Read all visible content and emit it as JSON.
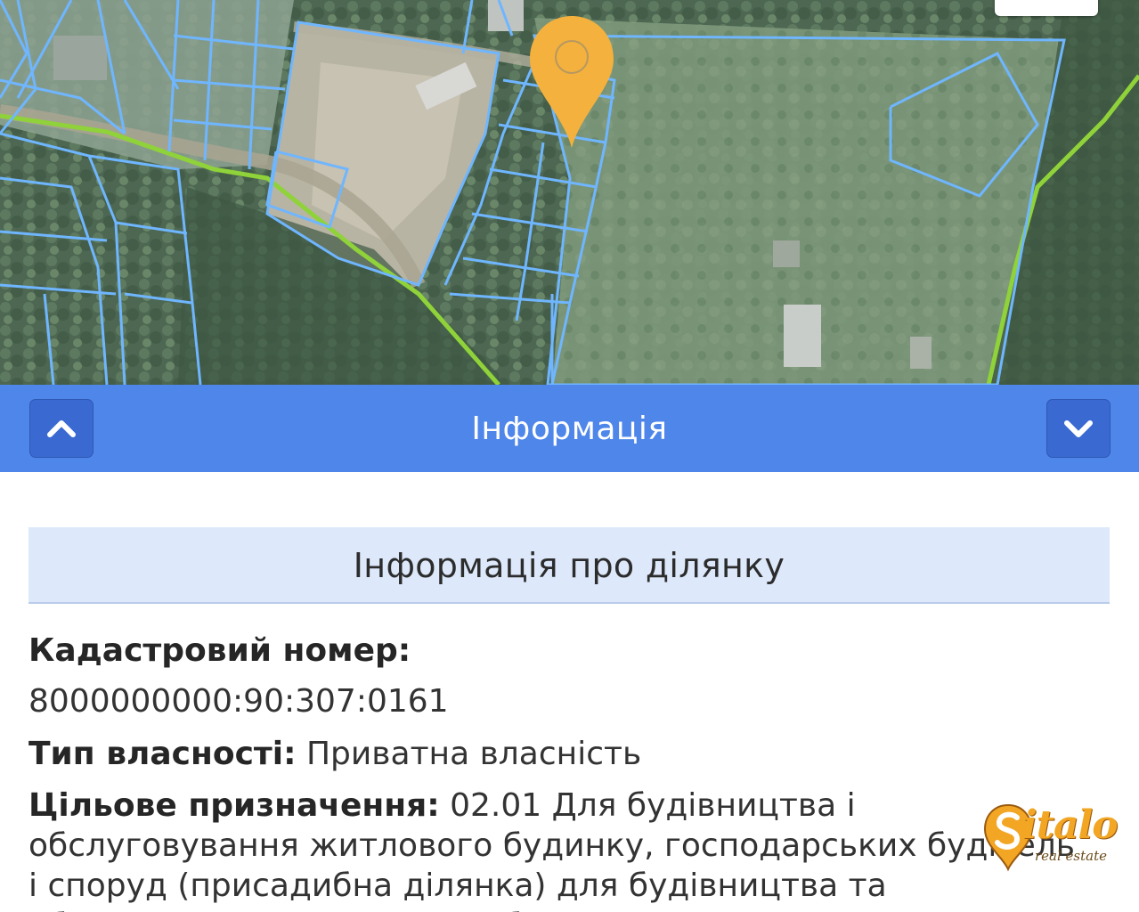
{
  "map": {
    "pin_icon": "map-pin-icon",
    "pin_color": "#f4b13d",
    "parcel_line_color": "#6fb6ff",
    "boundary_line_color": "#8fd23a"
  },
  "info_bar": {
    "title": "Інформація",
    "collapse_icon": "chevron-up-icon",
    "expand_icon": "chevron-down-icon",
    "color": "#4f86ea"
  },
  "parcel": {
    "section_title": "Інформація про ділянку",
    "cadastre_label": "Кадастровий номер:",
    "cadastre_number": "8000000000:90:307:0161",
    "ownership_label": "Тип власності:",
    "ownership_value": "Приватна власність",
    "purpose_label": "Цільове призначення:",
    "purpose_value": "02.01 Для будівництва і обслуговування житлового будинку, господарських будівель і споруд (присадибна ділянка) для будівництва та обслуговування житлового будинку,"
  },
  "watermark": {
    "brand": "italo",
    "tagline": "real estate"
  }
}
